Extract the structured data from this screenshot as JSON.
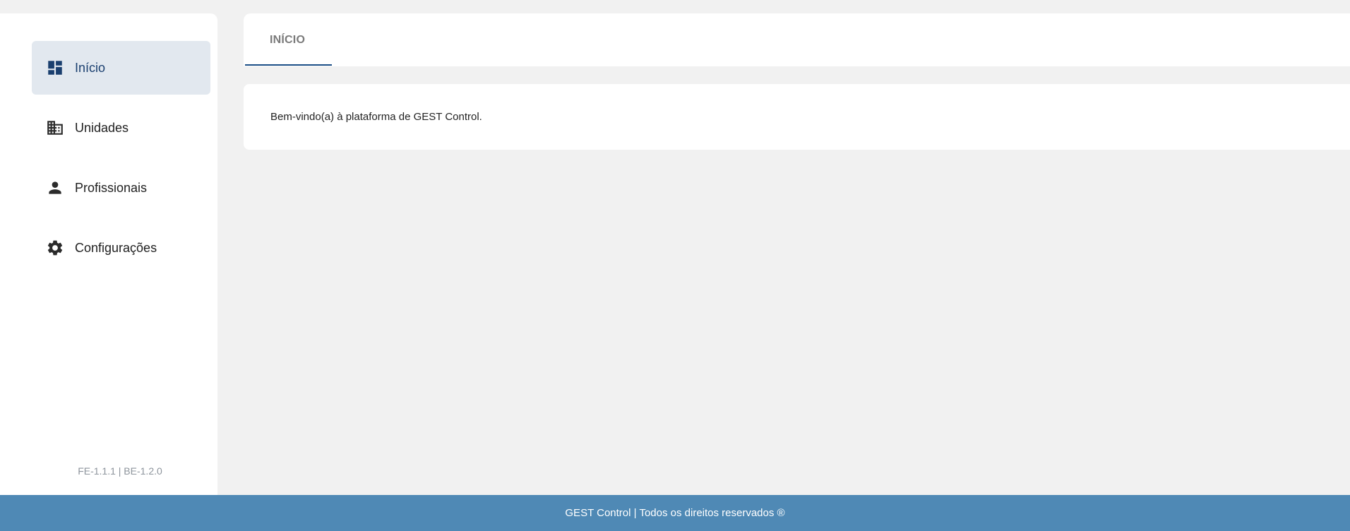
{
  "sidebar": {
    "items": [
      {
        "label": "Início",
        "icon": "dashboard-icon",
        "active": true
      },
      {
        "label": "Unidades",
        "icon": "building-icon",
        "active": false
      },
      {
        "label": "Profissionais",
        "icon": "person-icon",
        "active": false
      },
      {
        "label": "Configurações",
        "icon": "gear-icon",
        "active": false
      }
    ],
    "version": "FE-1.1.1 | BE-1.2.0"
  },
  "main": {
    "tabs": [
      {
        "label": "INÍCIO",
        "active": true
      }
    ],
    "welcome_text": "Bem-vindo(a) à plataforma de GEST Control."
  },
  "footer": {
    "text": "GEST Control | Todos os direitos reservados ®"
  },
  "colors": {
    "accent": "#1a4e86",
    "active_bg": "#e2e8ef",
    "footer_bg": "#4f89b5",
    "page_bg": "#f1f1f1"
  }
}
